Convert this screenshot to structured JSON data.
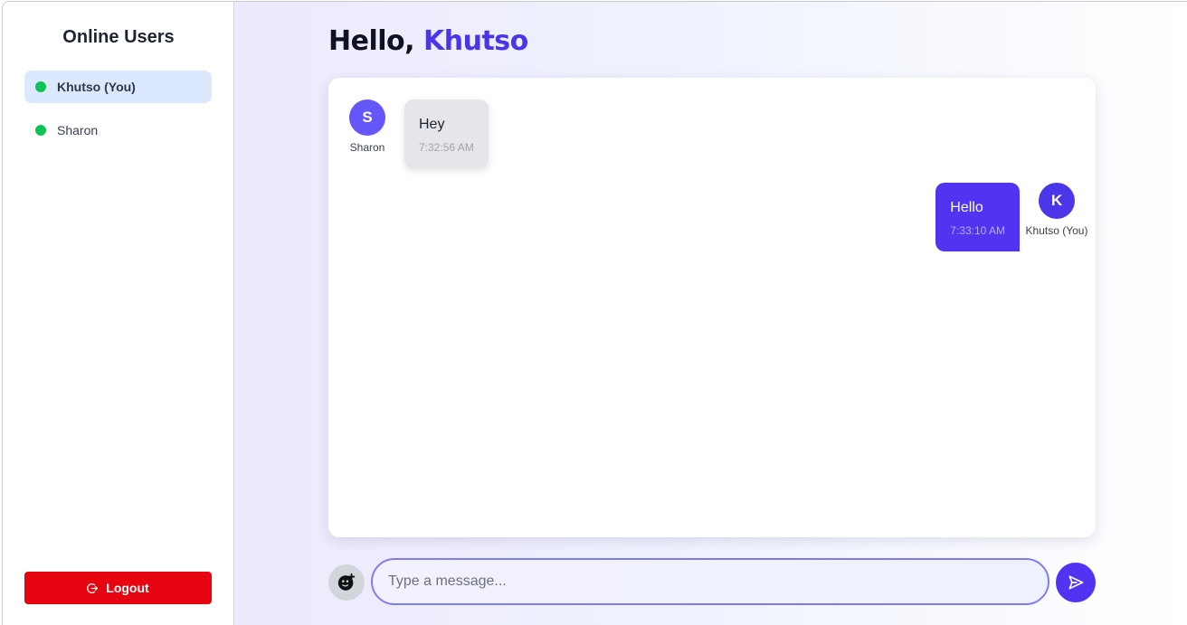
{
  "sidebar": {
    "title": "Online Users",
    "users": [
      {
        "name": "Khutso (You)",
        "active": true
      },
      {
        "name": "Sharon",
        "active": false
      }
    ],
    "logout_label": "Logout"
  },
  "header": {
    "greeting": "Hello,",
    "username": "Khutso"
  },
  "messages": [
    {
      "sender": "Sharon",
      "initial": "S",
      "text": "Hey",
      "time": "7:32:56 AM",
      "direction": "incoming"
    },
    {
      "sender": "Khutso (You)",
      "initial": "K",
      "text": "Hello",
      "time": "7:33:10 AM",
      "direction": "outgoing"
    }
  ],
  "composer": {
    "placeholder": "Type a message...",
    "emoji_icon": "emoji-icon",
    "send_icon": "send-icon"
  },
  "colors": {
    "accent": "#4a35e8",
    "online": "#0fc456",
    "logout": "#e5040f",
    "outgoing_bubble": "#5134f2",
    "incoming_bubble": "#e5e6ea"
  }
}
